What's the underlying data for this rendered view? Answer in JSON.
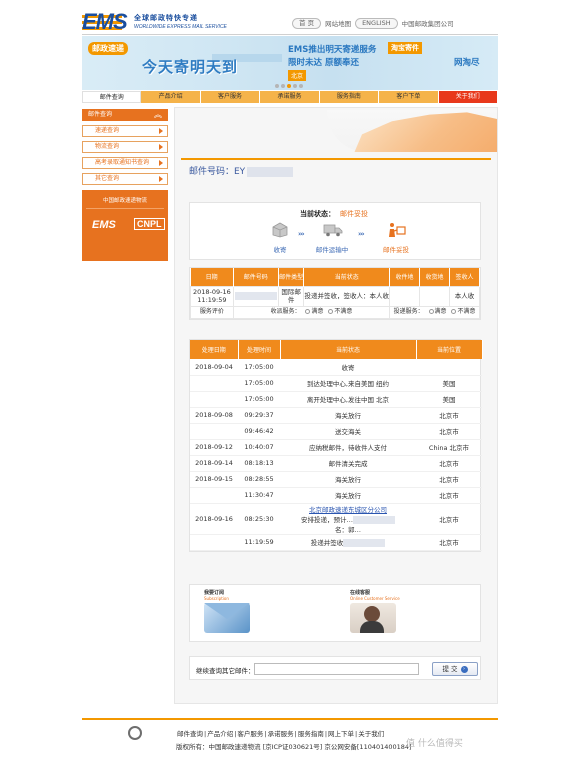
{
  "header": {
    "logo_text": "EMS",
    "logo_cn": "全球邮政特快专递",
    "logo_en": "WORLDWIDE EXPRESS MAIL SERVICE",
    "nav": [
      "首 页",
      "网站地图",
      "ENGLISH",
      "中国邮政集团公司"
    ]
  },
  "banner": {
    "badge": "邮政速递",
    "headline": "今天寄明天到",
    "line1": "EMS推出明天寄递服务",
    "line2": "限时未达 原额奉还",
    "tag": "北京",
    "right_tag": "淘宝寄件",
    "right_text": "网淘尽"
  },
  "mainnav": [
    "邮件查询",
    "产品介绍",
    "客户服务",
    "承诺服务",
    "服务指南",
    "客户下单",
    "关于我们"
  ],
  "sidebar": {
    "title": "邮件查询",
    "items": [
      "速递查询",
      "物流查询",
      "高考录取通知书查询",
      "其它查询"
    ],
    "ad_top": "中国邮政速递物流",
    "ad_brand": "EMS",
    "ad_brand2": "CNPL"
  },
  "content": {
    "mailno_label": "邮件号码：EY",
    "status_label": "当前状态：",
    "status_value": "邮件妥投",
    "steps": [
      "收寄",
      "邮件运输中",
      "邮件妥投"
    ],
    "t1_headers": [
      "日期",
      "邮件号码",
      "邮件类型",
      "当前状态",
      "收件地",
      "收货地",
      "签收人"
    ],
    "t1_row": {
      "date": "2018-09-16 11:19:59",
      "type": "国际邮件",
      "status": "投递并签收，签收人：本人收",
      "signer": "本人收"
    },
    "eval_label": "服务评价",
    "eval_send": "收派服务：",
    "eval_deliver": "投递服务：",
    "eval_ok": "满意",
    "eval_bad": "不满意",
    "t2_headers": [
      "处理日期",
      "处理时间",
      "当前状态",
      "当前位置"
    ],
    "t2_rows": [
      {
        "date": "2018-09-04",
        "time": "17:05:00",
        "status": "收寄",
        "loc": ""
      },
      {
        "date": "",
        "time": "17:05:00",
        "status": "到达处理中心,来自美国 纽约",
        "loc": "美国"
      },
      {
        "date": "",
        "time": "17:05:00",
        "status": "离开处理中心,发往中国 北京",
        "loc": "美国"
      },
      {
        "date": "2018-09-08",
        "time": "09:29:37",
        "status": "海关放行",
        "loc": "北京市"
      },
      {
        "date": "",
        "time": "09:46:42",
        "status": "送交海关",
        "loc": "北京市"
      },
      {
        "date": "2018-09-12",
        "time": "10:40:07",
        "status": "应纳税邮件，待收件人支付",
        "loc": "China 北京市"
      },
      {
        "date": "2018-09-14",
        "time": "08:18:13",
        "status": "邮件清关完成",
        "loc": "北京市"
      },
      {
        "date": "2018-09-15",
        "time": "08:28:55",
        "status": "海关放行",
        "loc": "北京市"
      },
      {
        "date": "",
        "time": "11:30:47",
        "status": "海关放行",
        "loc": "北京市"
      },
      {
        "date": "2018-09-16",
        "time": "08:25:30",
        "status": "北京邮政速递东城区分公司",
        "status2": "安排投递，预计…",
        "status3": "名：郭…",
        "loc": "北京市"
      },
      {
        "date": "",
        "time": "11:19:59",
        "status": "投递并签收",
        "loc": "北京市"
      }
    ],
    "card1_title": "我要订阅",
    "card1_sub": "Subscription",
    "card2_title": "在线客服",
    "card2_sub": "Online Customer Service",
    "card2_caption": "进入",
    "continue_label": "继续查询其它邮件：",
    "submit_label": "提 交"
  },
  "footer": {
    "links": [
      "邮件查询",
      "产品介绍",
      "客户服务",
      "承诺服务",
      "服务指南",
      "网上下单",
      "关于我们"
    ],
    "copyright": "版权所有：中国邮政速递物流 [京ICP证030621号] 京公网安备[110401400184]",
    "watermark": "值 什么值得买"
  },
  "colors": {
    "accent": "#f08a1c",
    "brand_blue": "#1a4e9e",
    "link": "#3c6ab5"
  }
}
